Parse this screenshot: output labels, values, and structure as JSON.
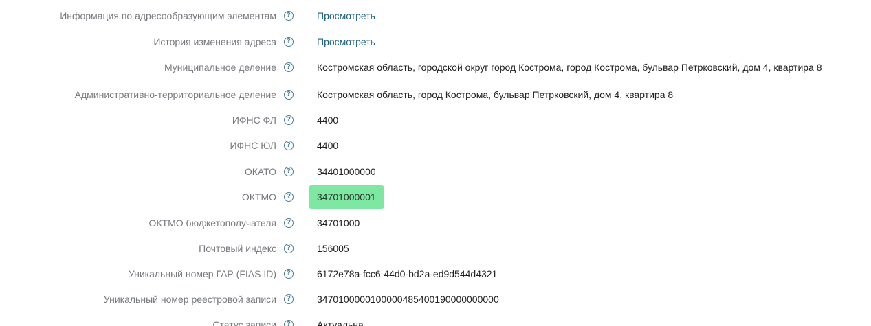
{
  "fields": [
    {
      "label": "Информация по адресообразующим элементам",
      "value": "Просмотреть"
    },
    {
      "label": "История изменения адреса",
      "value": "Просмотреть"
    },
    {
      "label": "Муниципальное деление",
      "value": "Костромская область, городской округ город Кострома, город Кострома, бульвар Петрковский, дом 4, квартира 8"
    },
    {
      "label": "Административно-территориальное деление",
      "value": "Костромская область, город Кострома, бульвар Петрковский, дом 4, квартира 8"
    },
    {
      "label": "ИФНС ФЛ",
      "value": "4400"
    },
    {
      "label": "ИФНС ЮЛ",
      "value": "4400"
    },
    {
      "label": "ОКАТО",
      "value": "34401000000"
    },
    {
      "label": "ОКТМО",
      "value": "34701000001"
    },
    {
      "label": "ОКТМО бюджетополучателя",
      "value": "34701000"
    },
    {
      "label": "Почтовый индекс",
      "value": "156005"
    },
    {
      "label": "Уникальный номер ГАР (FIAS ID)",
      "value": "6172e78a-fcc6-44d0-bd2a-ed9d544d4321"
    },
    {
      "label": "Уникальный номер реестровой записи",
      "value": "3470100000100000485400190000000000"
    },
    {
      "label": "Статус записи",
      "value": "Актуальна"
    }
  ],
  "help_glyph": "?",
  "icons": {
    "help": "question-circle-icon"
  },
  "colors": {
    "highlight": "#7ee8a2",
    "link": "#1f5f80",
    "label": "#777a80",
    "help": "#4a7d92"
  }
}
